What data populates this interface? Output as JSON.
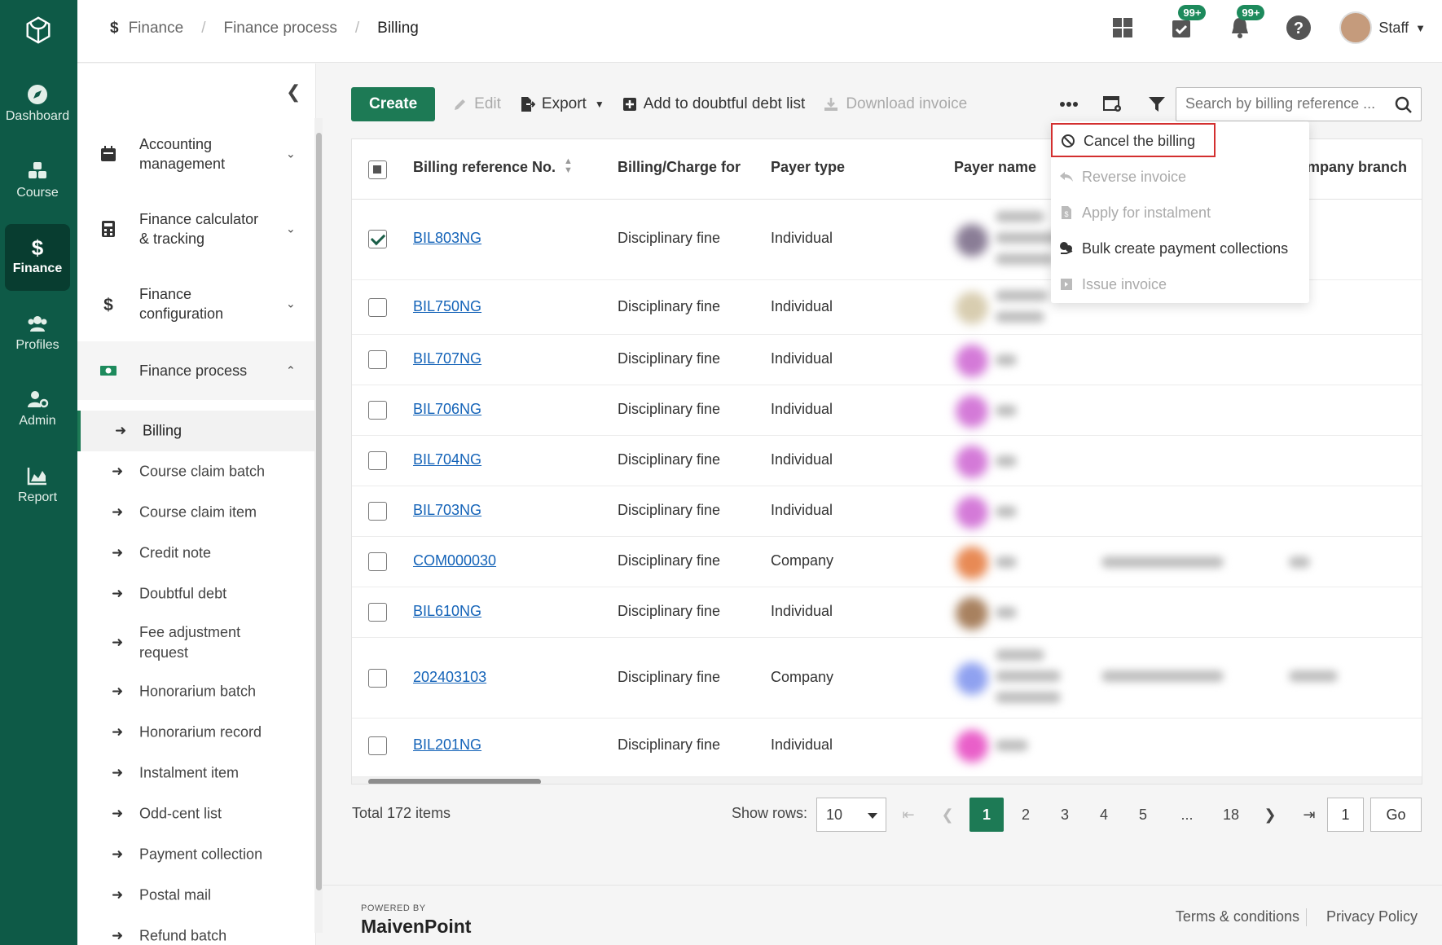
{
  "rail": {
    "items": [
      {
        "label": "Dashboard",
        "icon": "compass-icon"
      },
      {
        "label": "Course",
        "icon": "blocks-icon"
      },
      {
        "label": "Finance",
        "icon": "dollar-icon"
      },
      {
        "label": "Profiles",
        "icon": "users-icon"
      },
      {
        "label": "Admin",
        "icon": "user-gear-icon"
      },
      {
        "label": "Report",
        "icon": "area-chart-icon"
      }
    ]
  },
  "breadcrumb": [
    "Finance",
    "Finance process",
    "Billing"
  ],
  "header": {
    "badge_tasks": "99+",
    "badge_notifications": "99+",
    "user_label": "Staff"
  },
  "sidenav": {
    "groups": [
      {
        "label": "Accounting management"
      },
      {
        "label": "Finance calculator & tracking"
      },
      {
        "label": "Finance configuration"
      },
      {
        "label": "Finance process"
      }
    ],
    "sub_items": [
      "Billing",
      "Course claim batch",
      "Course claim item",
      "Credit note",
      "Doubtful debt",
      "Fee adjustment request",
      "Honorarium batch",
      "Honorarium record",
      "Instalment item",
      "Odd-cent list",
      "Payment collection",
      "Postal mail",
      "Refund batch"
    ]
  },
  "toolbar": {
    "create": "Create",
    "edit": "Edit",
    "export": "Export",
    "add_doubtful": "Add to doubtful debt list",
    "download_invoice": "Download invoice",
    "search_placeholder": "Search by billing reference ..."
  },
  "table": {
    "columns": [
      "Billing reference No.",
      "Billing/Charge for",
      "Payer type",
      "Payer name",
      "mpany branch"
    ],
    "rows": [
      {
        "ref": "BIL803NG",
        "charge": "Disciplinary fine",
        "payer_type": "Individual",
        "checked": true
      },
      {
        "ref": "BIL750NG",
        "charge": "Disciplinary fine",
        "payer_type": "Individual",
        "checked": false
      },
      {
        "ref": "BIL707NG",
        "charge": "Disciplinary fine",
        "payer_type": "Individual",
        "checked": false
      },
      {
        "ref": "BIL706NG",
        "charge": "Disciplinary fine",
        "payer_type": "Individual",
        "checked": false
      },
      {
        "ref": "BIL704NG",
        "charge": "Disciplinary fine",
        "payer_type": "Individual",
        "checked": false
      },
      {
        "ref": "BIL703NG",
        "charge": "Disciplinary fine",
        "payer_type": "Individual",
        "checked": false
      },
      {
        "ref": "COM000030",
        "charge": "Disciplinary fine",
        "payer_type": "Company",
        "checked": false
      },
      {
        "ref": "BIL610NG",
        "charge": "Disciplinary fine",
        "payer_type": "Individual",
        "checked": false
      },
      {
        "ref": "202403103",
        "charge": "Disciplinary fine",
        "payer_type": "Company",
        "checked": false
      },
      {
        "ref": "BIL201NG",
        "charge": "Disciplinary fine",
        "payer_type": "Individual",
        "checked": false
      }
    ]
  },
  "more_menu": {
    "items": [
      {
        "label": "Cancel the billing",
        "enabled": true
      },
      {
        "label": "Reverse invoice",
        "enabled": false
      },
      {
        "label": "Apply for instalment",
        "enabled": false
      },
      {
        "label": "Bulk create payment collections",
        "enabled": true
      },
      {
        "label": "Issue invoice",
        "enabled": false
      }
    ]
  },
  "pagination": {
    "total": "Total 172 items",
    "show_rows_label": "Show rows:",
    "rows_value": "10",
    "pages": [
      "1",
      "2",
      "3",
      "4",
      "5",
      "...",
      "18"
    ],
    "goto_value": "1",
    "go": "Go"
  },
  "footer": {
    "powered_by": "POWERED BY",
    "brand": "MaivenPoint",
    "terms": "Terms & conditions",
    "privacy": "Privacy Policy"
  },
  "colors": {
    "brand_green": "#0e5a47",
    "accent_green": "#1d7a55",
    "link_blue": "#1463b8",
    "highlight_red": "#d32f2f"
  }
}
